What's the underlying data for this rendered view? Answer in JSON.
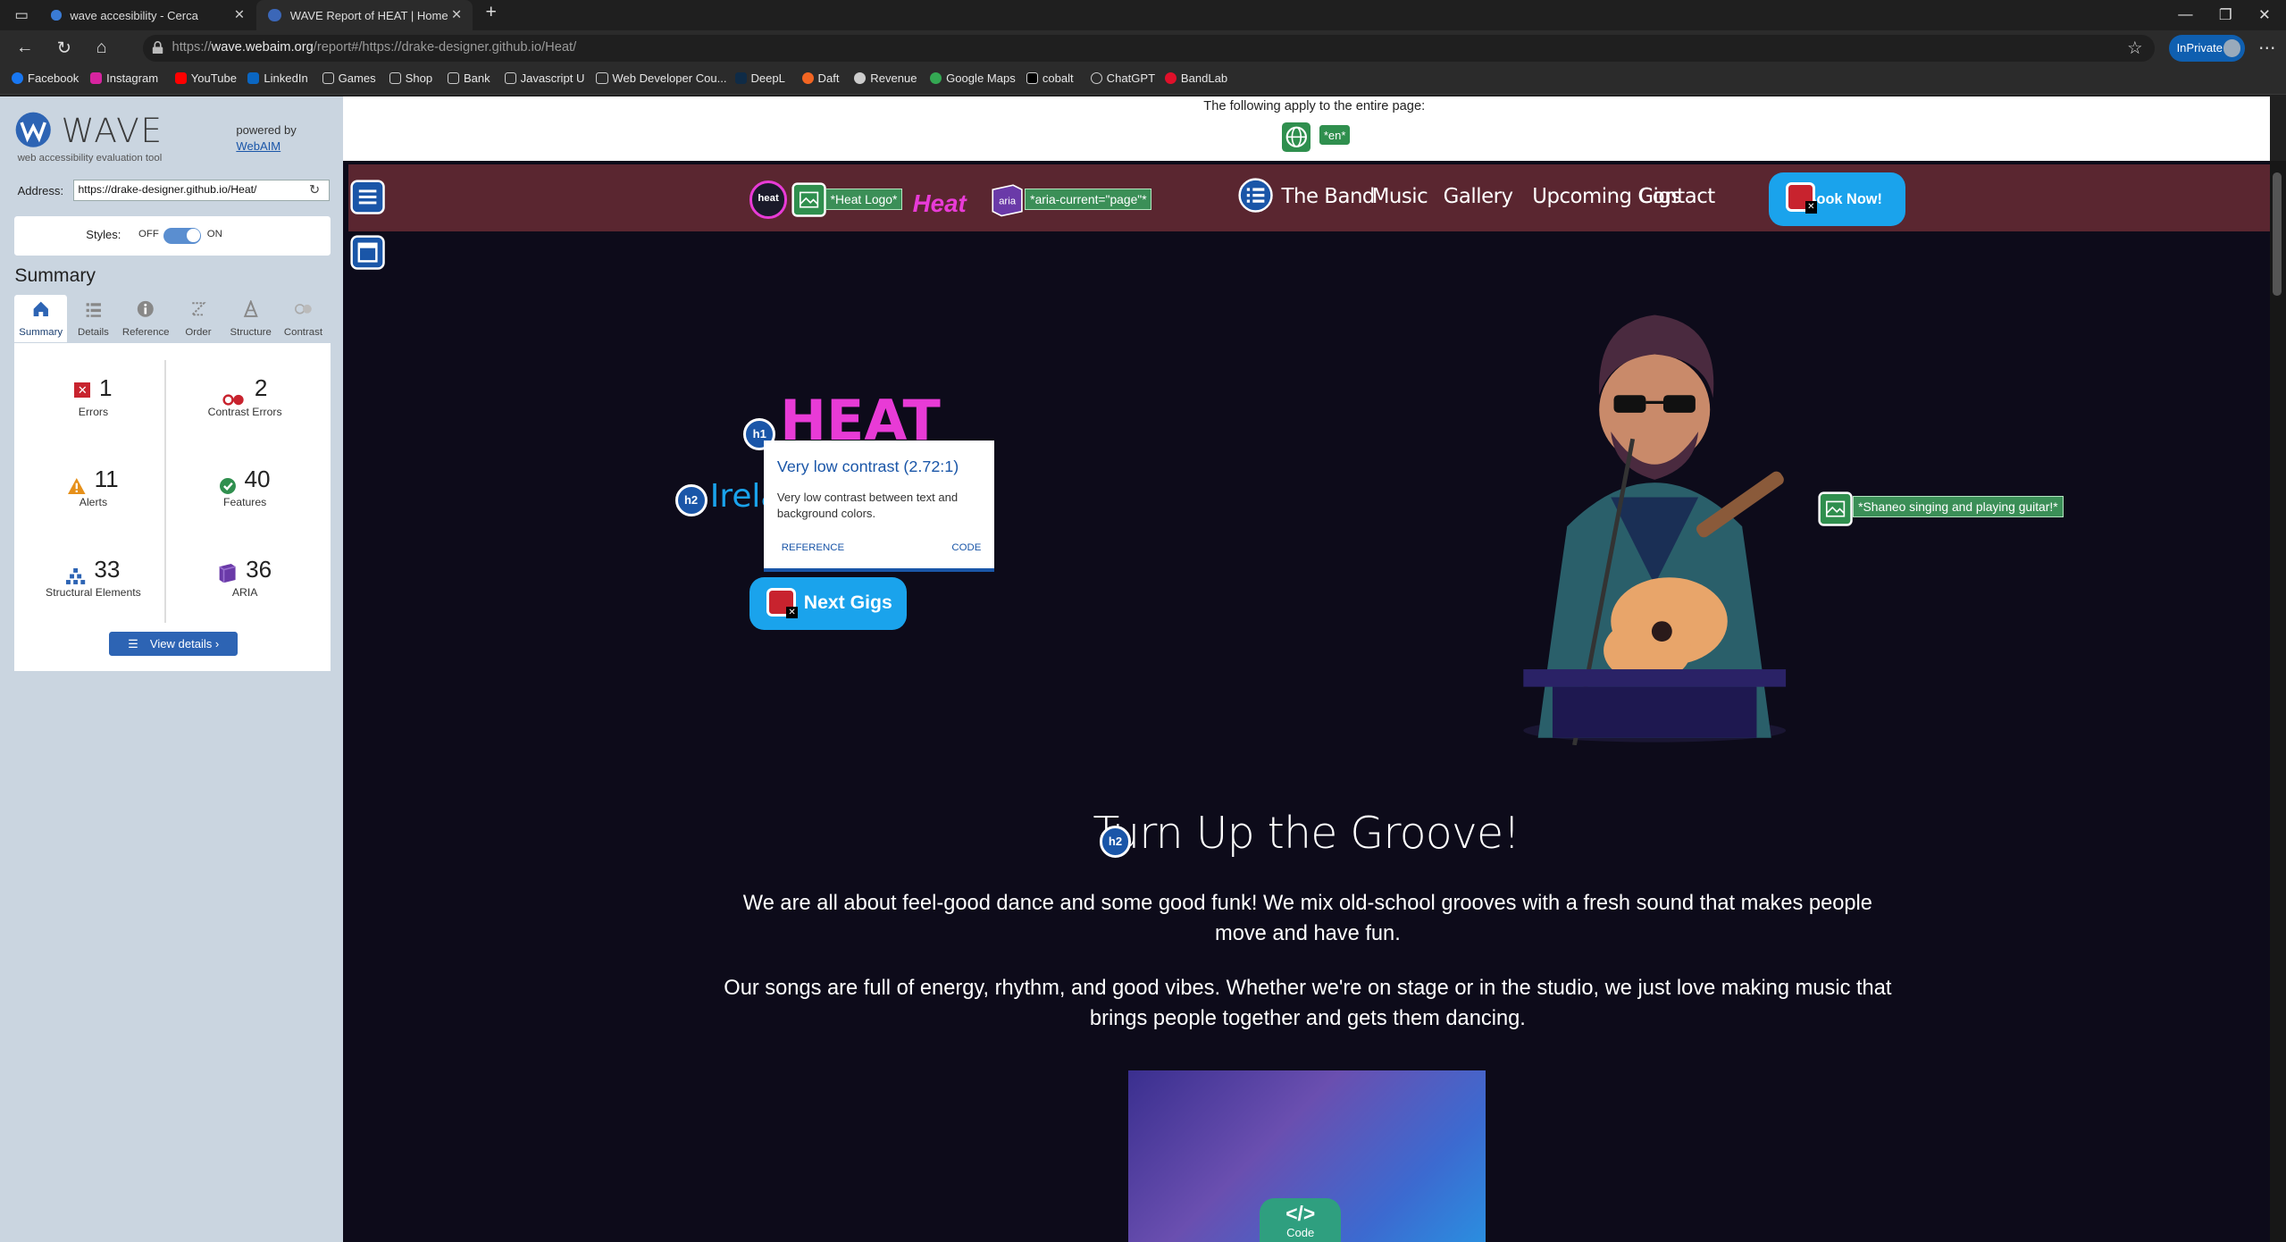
{
  "browser": {
    "tabs": [
      {
        "label": "wave accesibility - Cerca"
      },
      {
        "label": "WAVE Report of HEAT | Home"
      }
    ],
    "url_prefix": "https://",
    "url_domain": "wave.webaim.org",
    "url_rest": "/report#/https://drake-designer.github.io/Heat/",
    "inprivate": "InPrivate",
    "bookmarks": [
      "Facebook",
      "Instagram",
      "YouTube",
      "LinkedIn",
      "Games",
      "Shop",
      "Bank",
      "Javascript U",
      "Web Developer Cou...",
      "DeepL",
      "Daft",
      "Revenue",
      "Google Maps",
      "cobalt",
      "ChatGPT",
      "BandLab"
    ]
  },
  "wave": {
    "logo_text": "WAVE",
    "logo_sub": "web accessibility evaluation tool",
    "powered_by": "powered by",
    "webaim": "WebAIM",
    "address_label": "Address:",
    "address_value": "https://drake-designer.github.io/Heat/",
    "styles_label": "Styles:",
    "styles_off": "OFF",
    "styles_on": "ON",
    "summary_title": "Summary",
    "tabs": [
      "Summary",
      "Details",
      "Reference",
      "Order",
      "Structure",
      "Contrast"
    ],
    "stats": {
      "errors": {
        "value": "1",
        "label": "Errors"
      },
      "contrast": {
        "value": "2",
        "label": "Contrast Errors"
      },
      "alerts": {
        "value": "11",
        "label": "Alerts"
      },
      "features": {
        "value": "40",
        "label": "Features"
      },
      "structural": {
        "value": "33",
        "label": "Structural Elements"
      },
      "aria": {
        "value": "36",
        "label": "ARIA"
      }
    },
    "view_details": "View details ›"
  },
  "page": {
    "applies": "The following apply to the entire page:",
    "lang_tag": "*en*",
    "logo_alt_tag": "*Heat Logo*",
    "heat_logo": "Heat",
    "aria_tag": "*aria-current=\"page\"*",
    "nav": [
      "The Band",
      "Music",
      "Gallery",
      "Upcoming Gigs",
      "Contact"
    ],
    "book_now": "Book Now!",
    "h1": "HEAT",
    "h2_ireland": "Irela",
    "popup": {
      "title": "Very low contrast (2.72:1)",
      "desc": "Very low contrast between text and background colors.",
      "reference": "REFERENCE",
      "code": "CODE"
    },
    "next_gigs": "Next Gigs",
    "image_alt_tag": "*Shaneo singing and playing guitar!*",
    "groove": "Turn Up the Groove!",
    "para1": "We are all about feel-good dance and some good funk! We mix old-school grooves with a fresh sound that makes people move and have fun.",
    "para2": "Our songs are full of energy, rhythm, and good vibes. Whether we're on stage or in the studio, we just love making music that brings people together and gets them dancing.",
    "code_btn": "</>",
    "code_label": "Code"
  }
}
